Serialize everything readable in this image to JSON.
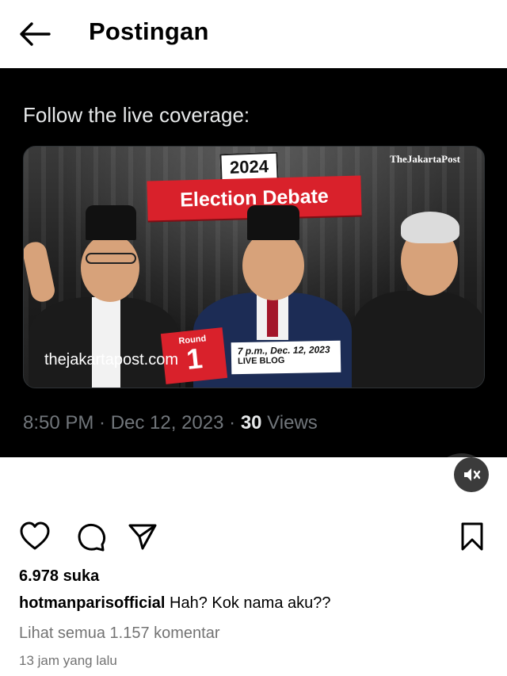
{
  "header": {
    "title": "Postingan",
    "back_icon": "arrow-left-icon"
  },
  "post": {
    "tweet": {
      "text": "Follow the live coverage:",
      "card": {
        "brand": "TheJakartaPost",
        "year": "2024",
        "event": "Election Debate",
        "round_label": "Round",
        "round_number": "1",
        "site": "thejakartapost.com",
        "time_line1": "7 p.m., Dec. 12, 2023",
        "time_line2": "LIVE BLOG"
      },
      "meta_time": "8:50 PM · Dec 12, 2023 · ",
      "views_count": "30",
      "views_label": " Views"
    },
    "overlay": {
      "scan_icon": "text-scan-icon",
      "mute_icon": "speaker-muted-icon"
    }
  },
  "actions": {
    "like_icon": "heart-icon",
    "comment_icon": "comment-icon",
    "share_icon": "send-icon",
    "save_icon": "bookmark-icon"
  },
  "likes": "6.978 suka",
  "caption": {
    "username": "hotmanparisofficial",
    "text": " Hah? Kok nama aku??"
  },
  "comments_link": "Lihat semua 1.157 komentar",
  "timestamp": "13 jam yang lalu",
  "colors": {
    "accent_red": "#d9212b",
    "x_blue": "#1d9bf0",
    "muted_gray": "#737373"
  }
}
